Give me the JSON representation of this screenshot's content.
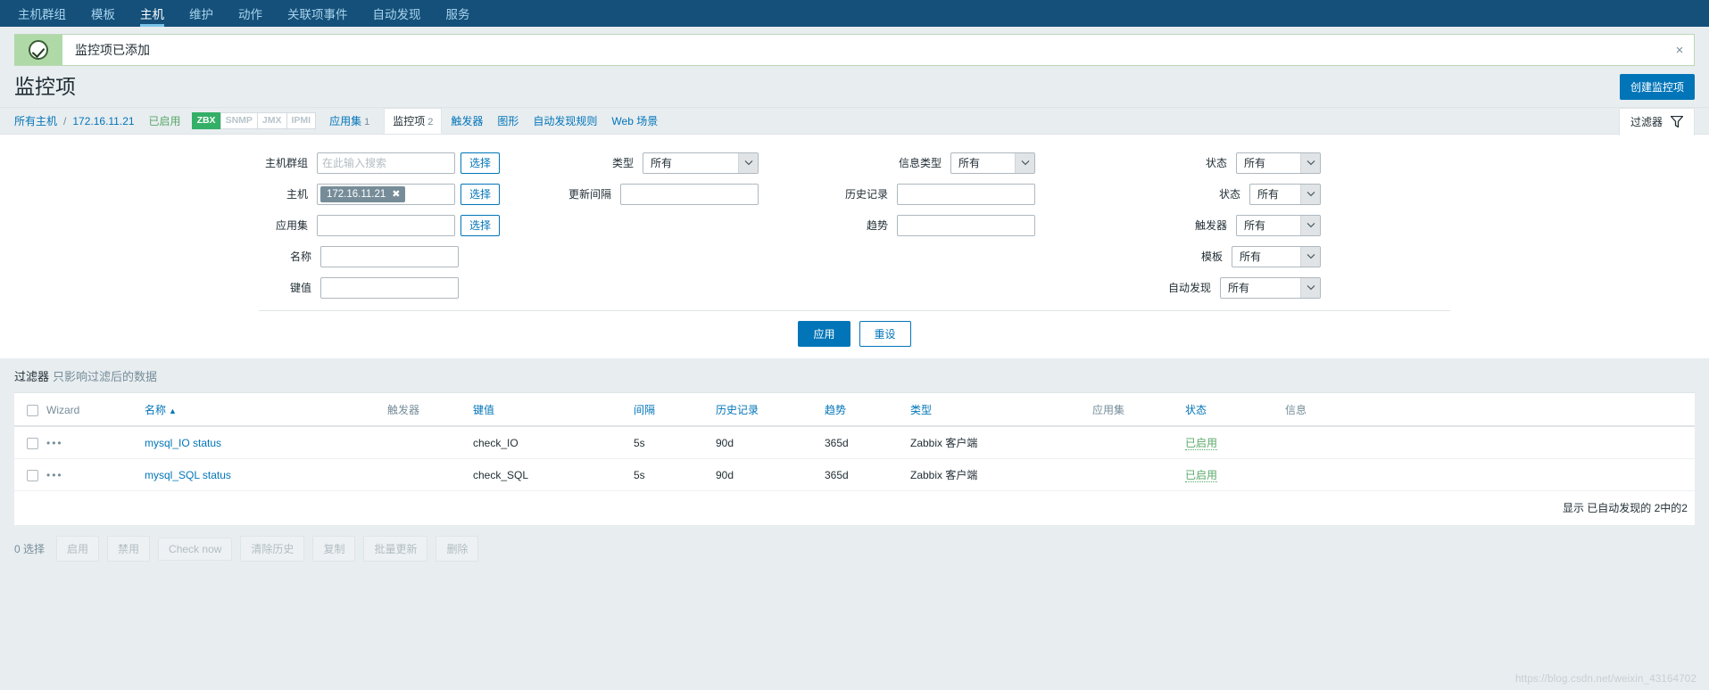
{
  "topnav": {
    "items": [
      {
        "label": "主机群组",
        "selected": false
      },
      {
        "label": "模板",
        "selected": false
      },
      {
        "label": "主机",
        "selected": true
      },
      {
        "label": "维护",
        "selected": false
      },
      {
        "label": "动作",
        "selected": false
      },
      {
        "label": "关联项事件",
        "selected": false
      },
      {
        "label": "自动发现",
        "selected": false
      },
      {
        "label": "服务",
        "selected": false
      }
    ]
  },
  "message": {
    "text": "监控项已添加",
    "close_label": "×",
    "icon": "check-circle-icon",
    "bg_color": "#b0d9a8"
  },
  "header": {
    "title": "监控项",
    "create_button": "创建监控项"
  },
  "breadcrumb": {
    "all_hosts": "所有主机",
    "separator": "/",
    "host": "172.16.11.21",
    "enabled": "已启用",
    "protocols": [
      {
        "label": "ZBX",
        "on": true
      },
      {
        "label": "SNMP",
        "on": false
      },
      {
        "label": "JMX",
        "on": false
      },
      {
        "label": "IPMI",
        "on": false
      }
    ],
    "tabs": [
      {
        "label": "应用集",
        "count": "1",
        "active": false
      },
      {
        "label": "监控项",
        "count": "2",
        "active": true
      },
      {
        "label": "触发器",
        "count": "",
        "active": false
      },
      {
        "label": "图形",
        "count": "",
        "active": false
      },
      {
        "label": "自动发现规则",
        "count": "",
        "active": false
      },
      {
        "label": "Web 场景",
        "count": "",
        "active": false
      }
    ],
    "filter_tab": "过滤器",
    "filter_icon": "funnel-icon"
  },
  "filter": {
    "host_group": {
      "label": "主机群组",
      "placeholder": "在此输入搜索",
      "value": "",
      "select_button": "选择"
    },
    "host": {
      "label": "主机",
      "chip": "172.16.11.21",
      "chip_remove": "✖",
      "select_button": "选择"
    },
    "application": {
      "label": "应用集",
      "value": "",
      "select_button": "选择"
    },
    "name": {
      "label": "名称",
      "value": ""
    },
    "key": {
      "label": "键值",
      "value": ""
    },
    "type": {
      "label": "类型",
      "value": "所有"
    },
    "update_interval": {
      "label": "更新间隔",
      "value": ""
    },
    "value_type": {
      "label": "信息类型",
      "value": "所有"
    },
    "history": {
      "label": "历史记录",
      "value": ""
    },
    "trends": {
      "label": "趋势",
      "value": ""
    },
    "status": {
      "label": "状态",
      "value": "所有"
    },
    "state": {
      "label": "状态",
      "value": "所有"
    },
    "triggers": {
      "label": "触发器",
      "value": "所有"
    },
    "templates": {
      "label": "模板",
      "value": "所有"
    },
    "discovery": {
      "label": "自动发现",
      "value": "所有"
    },
    "apply_button": "应用",
    "reset_button": "重设"
  },
  "filter_note": {
    "strong": "过滤器",
    "weak": "只影响过滤后的数据"
  },
  "table": {
    "columns": [
      {
        "key": "checkbox",
        "label": "",
        "link": false
      },
      {
        "key": "wizard",
        "label": "Wizard",
        "link": false
      },
      {
        "key": "name",
        "label": "名称",
        "link": true,
        "sorted": true,
        "sort_arrow": "▲"
      },
      {
        "key": "triggers",
        "label": "触发器",
        "link": false
      },
      {
        "key": "key",
        "label": "键值",
        "link": true
      },
      {
        "key": "interval",
        "label": "间隔",
        "link": true
      },
      {
        "key": "history",
        "label": "历史记录",
        "link": true
      },
      {
        "key": "trends",
        "label": "趋势",
        "link": true
      },
      {
        "key": "type",
        "label": "类型",
        "link": true
      },
      {
        "key": "application",
        "label": "应用集",
        "link": false
      },
      {
        "key": "status",
        "label": "状态",
        "link": true
      },
      {
        "key": "info",
        "label": "信息",
        "link": false
      }
    ],
    "rows": [
      {
        "wizard": "•••",
        "name": "mysql_IO status",
        "triggers": "",
        "key": "check_IO",
        "interval": "5s",
        "history": "90d",
        "trends": "365d",
        "type": "Zabbix 客户端",
        "application": "",
        "status": "已启用",
        "info": ""
      },
      {
        "wizard": "•••",
        "name": "mysql_SQL status",
        "triggers": "",
        "key": "check_SQL",
        "interval": "5s",
        "history": "90d",
        "trends": "365d",
        "type": "Zabbix 客户端",
        "application": "",
        "status": "已启用",
        "info": ""
      }
    ],
    "footer": "显示 已自动发现的 2中的2"
  },
  "footer_actions": {
    "selected_count": "0 选择",
    "buttons": [
      "启用",
      "禁用",
      "Check now",
      "清除历史",
      "复制",
      "批量更新",
      "删除"
    ]
  },
  "watermark": "https://blog.csdn.net/weixin_43164702"
}
